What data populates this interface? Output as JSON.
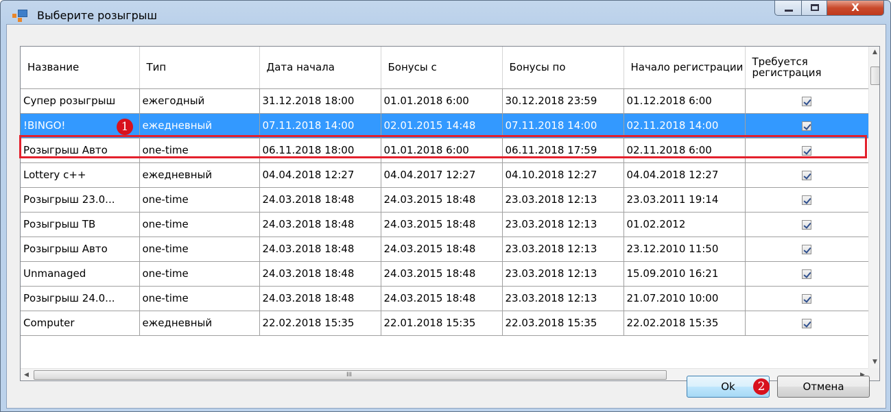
{
  "window": {
    "title": "Выберите розыгрыш",
    "close_glyph": "X"
  },
  "grid": {
    "columns": [
      "Название",
      "Тип",
      "Дата начала",
      "Бонусы с",
      "Бонусы по",
      "Начало регистрации",
      "Требуется регистрация"
    ],
    "rows": [
      {
        "name": "Супер розыгрыш",
        "type": "ежегодный",
        "start": "31.12.2018 18:00",
        "bonus_from": "01.01.2018 6:00",
        "bonus_to": "30.12.2018 23:59",
        "reg_start": "01.12.2018 6:00",
        "reg_required": true
      },
      {
        "name": "!BINGO!",
        "type": "ежедневный",
        "start": "07.11.2018 14:00",
        "bonus_from": "02.01.2015 14:48",
        "bonus_to": "07.11.2018 14:00",
        "reg_start": "02.11.2018 14:00",
        "reg_required": true
      },
      {
        "name": "Розыгрыш Авто",
        "type": "one-time",
        "start": "06.11.2018 18:00",
        "bonus_from": "01.01.2018 6:00",
        "bonus_to": "06.11.2018 17:59",
        "reg_start": "02.11.2018 6:00",
        "reg_required": true
      },
      {
        "name": "Lottery c++",
        "type": "ежедневный",
        "start": "04.04.2018 12:27",
        "bonus_from": "04.04.2017 12:27",
        "bonus_to": "04.10.2018 12:27",
        "reg_start": "04.04.2018 12:27",
        "reg_required": true
      },
      {
        "name": "Розыгрыш 23.0...",
        "type": "one-time",
        "start": "24.03.2018 18:48",
        "bonus_from": "24.03.2015 18:48",
        "bonus_to": "23.03.2018 12:13",
        "reg_start": "23.03.2011 19:14",
        "reg_required": true
      },
      {
        "name": "Розыгрыш ТВ",
        "type": "one-time",
        "start": "24.03.2018 18:48",
        "bonus_from": "24.03.2015 18:48",
        "bonus_to": "23.03.2018 12:13",
        "reg_start": "01.02.2012",
        "reg_required": true
      },
      {
        "name": "Розыгрыш Авто",
        "type": "one-time",
        "start": "24.03.2018 18:48",
        "bonus_from": "24.03.2015 18:48",
        "bonus_to": "23.03.2018 12:13",
        "reg_start": "23.12.2010 11:50",
        "reg_required": true
      },
      {
        "name": "Unmanaged",
        "type": "one-time",
        "start": "24.03.2018 18:48",
        "bonus_from": "24.03.2015 18:48",
        "bonus_to": "23.03.2018 12:13",
        "reg_start": "15.09.2010 16:21",
        "reg_required": true
      },
      {
        "name": "Розыгрыш 24.0...",
        "type": "one-time",
        "start": "24.03.2018 18:48",
        "bonus_from": "24.03.2015 18:48",
        "bonus_to": "23.03.2018 12:13",
        "reg_start": "21.07.2010 10:00",
        "reg_required": true
      },
      {
        "name": "Computer",
        "type": "ежедневный",
        "start": "22.02.2018 15:35",
        "bonus_from": "22.01.2018 15:35",
        "bonus_to": "22.03.2018 15:35",
        "reg_start": "22.02.2018 15:35",
        "reg_required": true
      }
    ],
    "selected_row_index": 1,
    "hscroll_grip": "III"
  },
  "buttons": {
    "ok_label": "Ok",
    "cancel_label": "Отмена"
  },
  "annotations": {
    "marker_1": "1",
    "marker_2": "2"
  },
  "colors": {
    "selection": "#3399ff",
    "highlight_frame": "#e3202c",
    "marker": "#d8111d"
  }
}
